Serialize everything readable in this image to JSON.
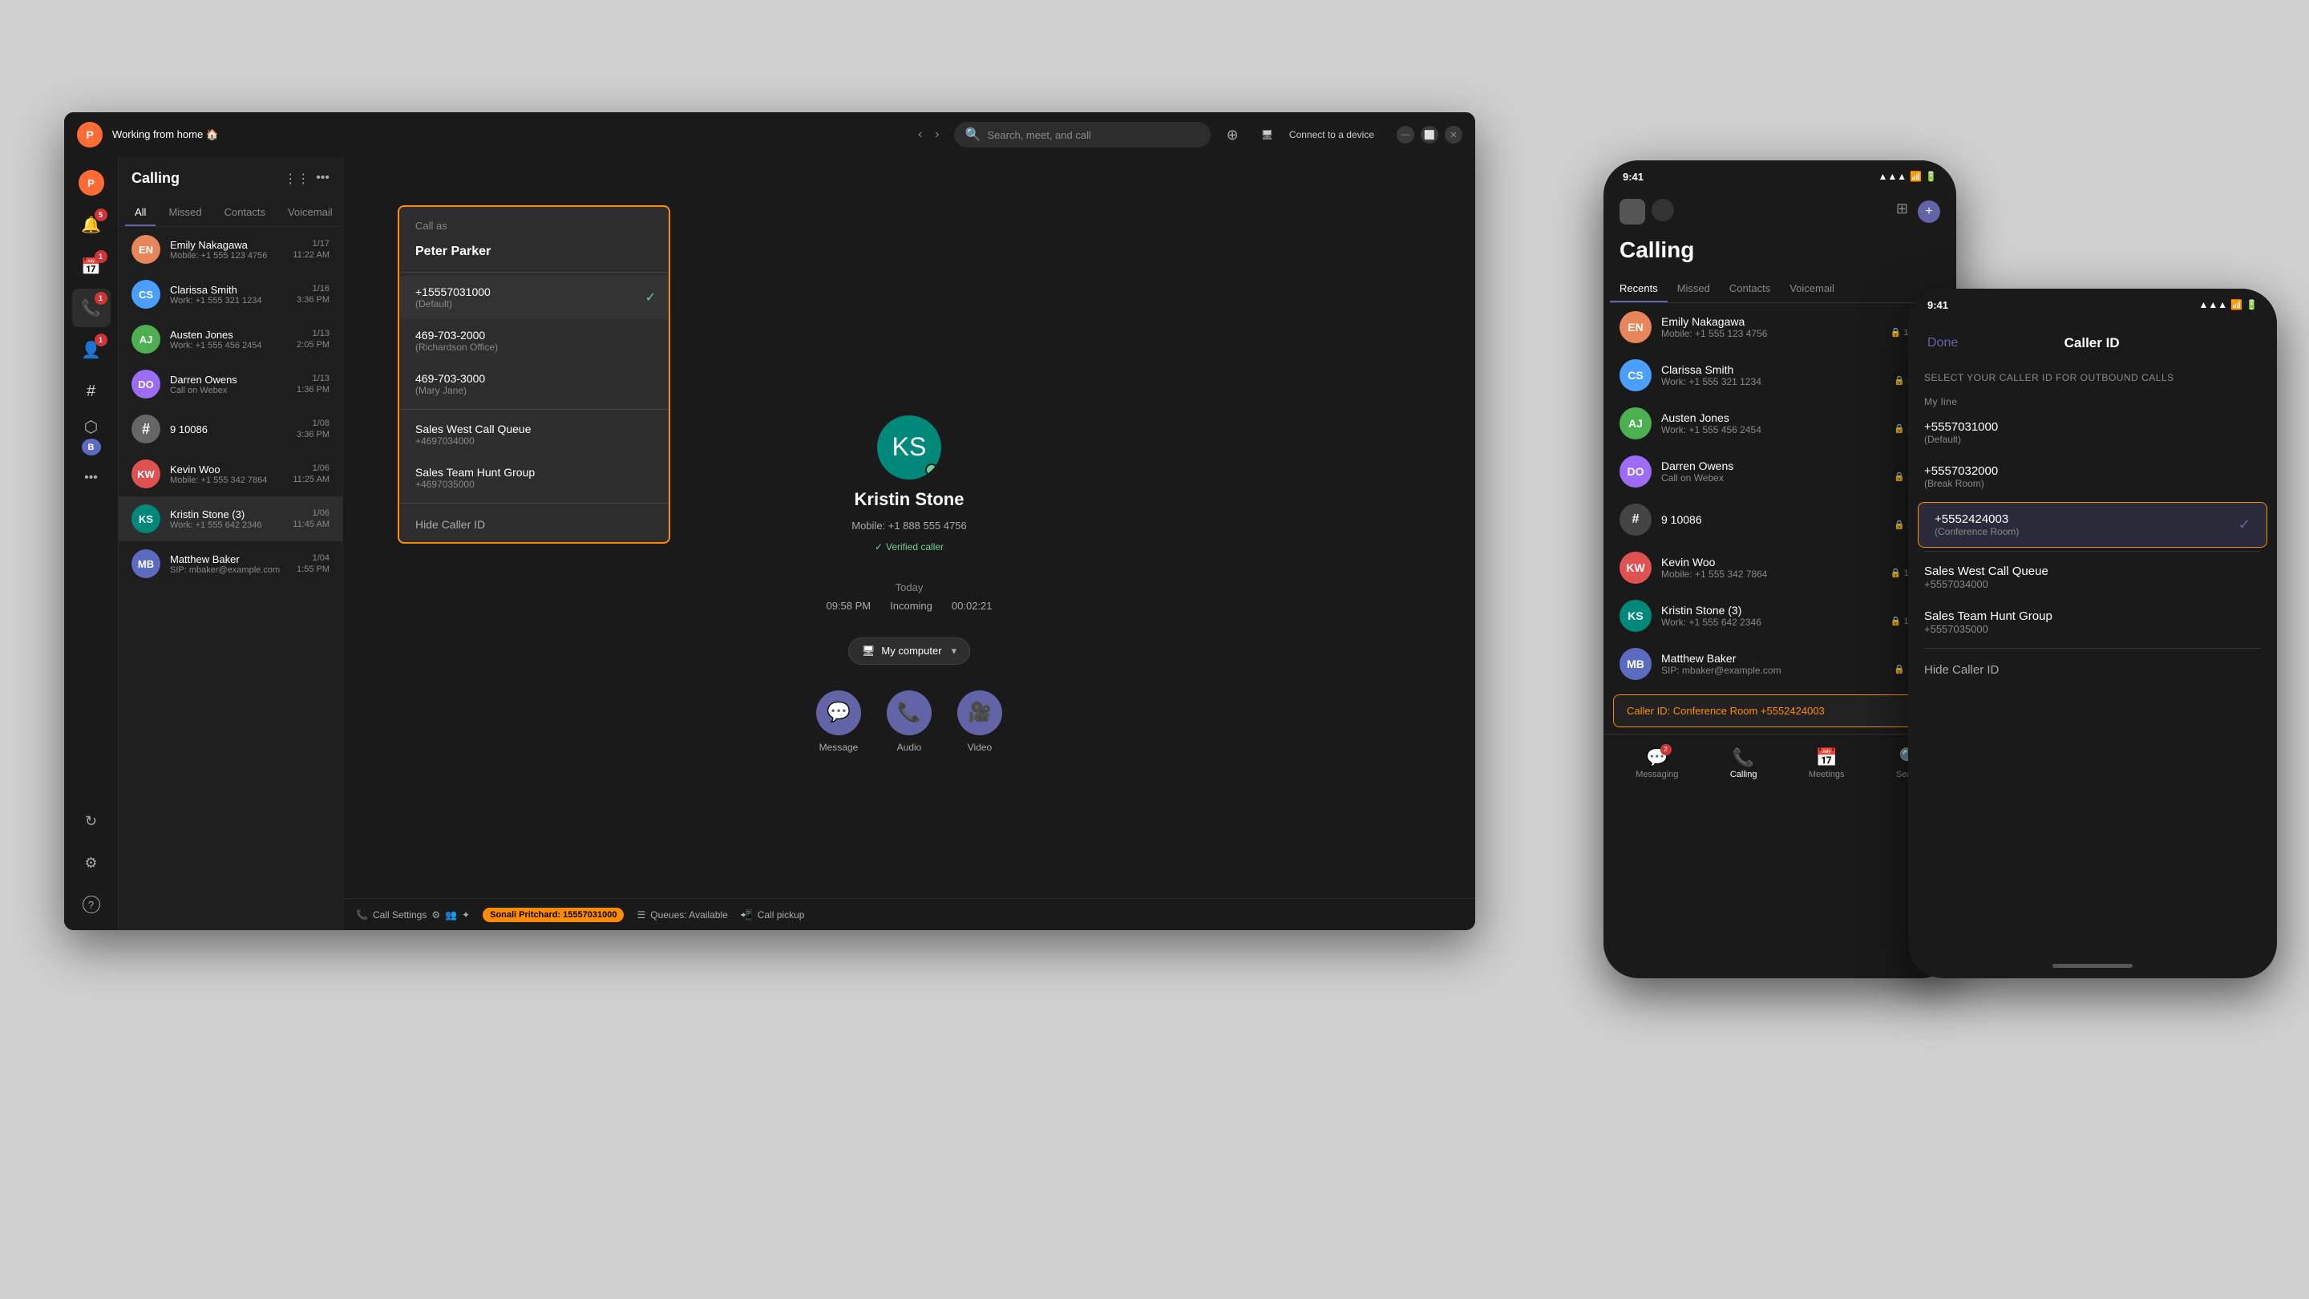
{
  "window": {
    "title": "Working from home 🏠",
    "search_placeholder": "Search, meet, and call",
    "connect_device": "Connect to a device"
  },
  "sidebar": {
    "items": [
      {
        "id": "activity",
        "icon": "🔔",
        "badge": "5"
      },
      {
        "id": "calendar",
        "icon": "📅",
        "badge": "1"
      },
      {
        "id": "calls",
        "icon": "📞",
        "badge": "1"
      },
      {
        "id": "contacts",
        "icon": "👤",
        "badge": "1"
      },
      {
        "id": "hash",
        "icon": "#"
      },
      {
        "id": "apps",
        "icon": "⬡"
      },
      {
        "id": "more",
        "icon": "···"
      }
    ],
    "bottom_items": [
      {
        "id": "refresh",
        "icon": "🔄"
      },
      {
        "id": "settings",
        "icon": "⚙️"
      },
      {
        "id": "help",
        "icon": "?"
      }
    ]
  },
  "calling_panel": {
    "title": "Calling",
    "tabs": [
      "All",
      "Missed",
      "Contacts",
      "Voicemail"
    ]
  },
  "contacts": [
    {
      "name": "Emily Nakagawa",
      "detail": "Mobile: +1 555 123 4756",
      "time": "1/17",
      "time2": "11:22 AM",
      "initials": "EN",
      "color": "av-orange"
    },
    {
      "name": "Clarissa Smith",
      "detail": "Work: +1 555 321 1234",
      "time": "1/16",
      "time2": "3:36 PM",
      "initials": "CS",
      "color": "av-blue"
    },
    {
      "name": "Austen Jones",
      "detail": "Work: +1 555 456 2454",
      "time": "1/13",
      "time2": "2:05 PM",
      "initials": "AJ",
      "color": "av-green"
    },
    {
      "name": "Darren Owens",
      "detail": "Call on Webex",
      "time": "1/13",
      "time2": "1:36 PM",
      "initials": "DO",
      "color": "av-purple"
    },
    {
      "name": "9 10086",
      "detail": "",
      "time": "1/08",
      "time2": "3:36 PM",
      "initials": "#",
      "color": "av-gray",
      "is_hash": true
    },
    {
      "name": "Kevin Woo",
      "detail": "Mobile: +1 555 342 7864",
      "time": "1/06",
      "time2": "11:25 AM",
      "initials": "KW",
      "color": "av-red"
    },
    {
      "name": "Kristin Stone (3)",
      "detail": "Work: +1 555 642 2346",
      "time": "1/06",
      "time2": "11:45 AM",
      "initials": "KS",
      "color": "av-teal"
    },
    {
      "name": "Matthew Baker",
      "detail": "SIP: mbaker@example.com",
      "time": "1/04",
      "time2": "1:55 PM",
      "initials": "MB",
      "color": "av-indigo"
    }
  ],
  "main_contact": {
    "name": "Kristin Stone",
    "phone": "Mobile: +1 888 555 4756",
    "verified": "Verified caller",
    "initials": "KS",
    "history_date": "Today",
    "history_time": "09:58 PM",
    "history_type": "Incoming",
    "history_duration": "00:02:21",
    "device": "My computer"
  },
  "action_buttons": [
    {
      "id": "message",
      "icon": "💬",
      "label": "Message"
    },
    {
      "id": "audio",
      "icon": "📞",
      "label": "Audio"
    },
    {
      "id": "video",
      "icon": "🎥",
      "label": "Video"
    }
  ],
  "status_bar": {
    "call_settings": "Call Settings",
    "active_caller": "Sonali Pritchard: 15557031000",
    "queues": "Queues: Available",
    "call_pickup": "Call pickup"
  },
  "caller_id_dropdown": {
    "header": "Call as",
    "user": "Peter Parker",
    "options": [
      {
        "id": "default",
        "number": "+15557031000",
        "label": "(Default)",
        "selected": true
      },
      {
        "id": "richardson",
        "number": "469-703-2000",
        "label": "(Richardson Office)",
        "selected": false
      },
      {
        "id": "mary-jane",
        "number": "469-703-3000",
        "label": "(Mary Jane)",
        "selected": false
      },
      {
        "id": "sales-west",
        "number": "+4697034000",
        "label": "Sales West Call Queue",
        "is_group": true
      },
      {
        "id": "sales-team",
        "number": "+4697035000",
        "label": "Sales Team Hunt Group",
        "is_group": true
      }
    ],
    "hide_label": "Hide Caller ID"
  },
  "mobile1": {
    "time": "9:41",
    "title": "Calling",
    "tabs": [
      "Recents",
      "Missed",
      "Contacts",
      "Voicemail"
    ],
    "active_tab": "Recents",
    "caller_id_bar": "Caller ID: Conference Room +5552424003",
    "nav": [
      {
        "id": "messaging",
        "label": "Messaging",
        "icon": "💬",
        "badge": "2"
      },
      {
        "id": "calling",
        "label": "Calling",
        "icon": "📞",
        "active": true
      },
      {
        "id": "meetings",
        "label": "Meetings",
        "icon": "📅"
      },
      {
        "id": "search",
        "label": "Search",
        "icon": "🔍"
      }
    ]
  },
  "mobile2": {
    "time": "9:41",
    "title": "Caller ID",
    "done": "Done",
    "subtitle": "SELECT YOUR CALLER ID FOR OUTBOUND CALLS",
    "my_line": "My line",
    "options": [
      {
        "number": "+5557031000",
        "sub": "(Default)",
        "selected": false
      },
      {
        "number": "+5557032000",
        "sub": "(Break Room)",
        "selected": false
      },
      {
        "number": "+5552424003",
        "sub": "(Conference Room)",
        "selected": true
      },
      {
        "label": "Sales West Call Queue",
        "sub": "+5557034000",
        "selected": false
      },
      {
        "label": "Sales Team Hunt Group",
        "sub": "+5557035000",
        "selected": false
      }
    ],
    "hide_label": "Hide Caller ID"
  }
}
